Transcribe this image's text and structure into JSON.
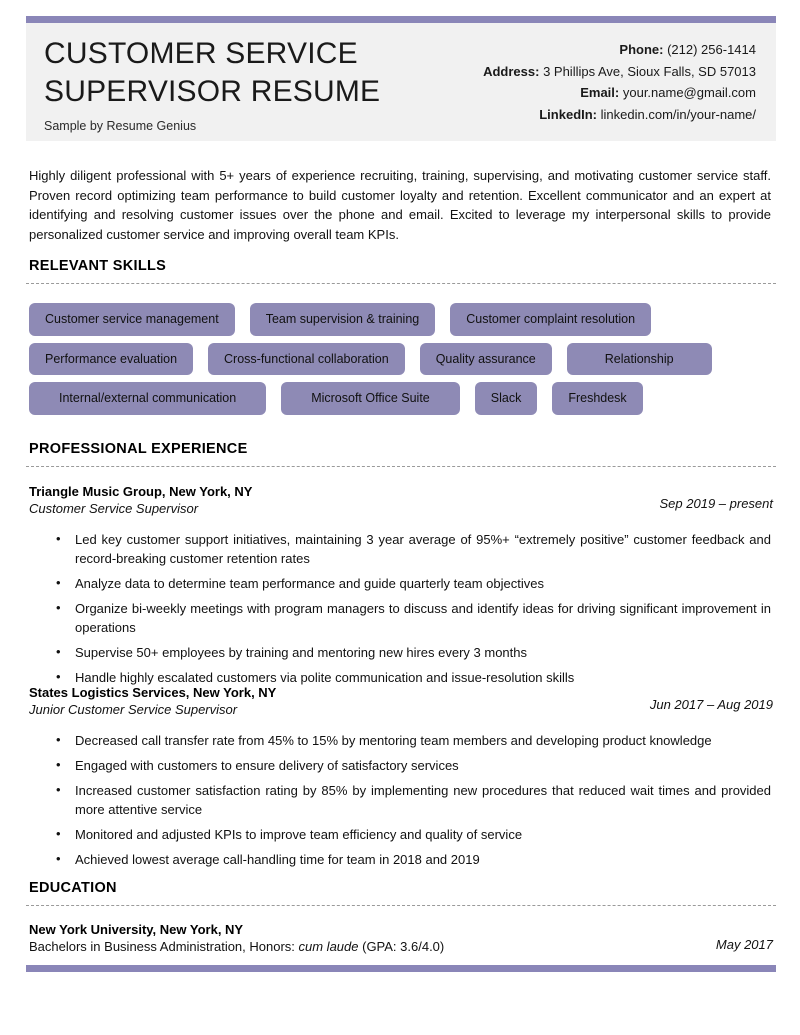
{
  "theme": {
    "accent_color": "#8a86b8",
    "tag_color": "#8e8ab5",
    "header_bg": "#f1f1f1"
  },
  "header": {
    "name_title": "CUSTOMER SERVICE\nSUPERVISOR RESUME",
    "byline": "Sample by Resume Genius",
    "contact": [
      {
        "label": "Phone:",
        "value": "(212) 256-1414"
      },
      {
        "label": "Address:",
        "value": "3 Phillips Ave, Sioux Falls, SD 57013"
      },
      {
        "label": "Email:",
        "value": "your.name@gmail.com"
      },
      {
        "label": "LinkedIn:",
        "value": "linkedin.com/in/your-name/"
      }
    ]
  },
  "summary": "Highly diligent professional with 5+ years of experience recruiting, training, supervising, and motivating customer service staff. Proven record optimizing team performance to build customer loyalty and retention. Excellent communicator and an expert at identifying and resolving customer issues over the phone and email. Excited to leverage my interpersonal skills to provide personalized customer service and improving overall team KPIs.",
  "sections": {
    "skills_heading": "RELEVANT SKILLS",
    "experience_heading": "PROFESSIONAL EXPERIENCE",
    "education_heading": "EDUCATION"
  },
  "skills": {
    "row1": [
      "Customer service management",
      "Team supervision & training",
      "Customer complaint resolution"
    ],
    "row2": [
      "Performance evaluation",
      "Cross-functional collaboration",
      "Quality assurance",
      "Relationship"
    ],
    "row3": [
      "Internal/external communication",
      "Microsoft Office Suite",
      "Slack",
      "Freshdesk"
    ]
  },
  "experience": [
    {
      "organization": "Triangle Music Group, New York, NY",
      "role": "Customer Service Supervisor",
      "date": "Sep 2019 – present",
      "bullets": [
        "Led key customer support initiatives, maintaining 3 year average of 95%+ “extremely positive” customer feedback and record-breaking customer retention rates",
        "Analyze data to determine team performance and guide quarterly team objectives",
        "Organize bi-weekly meetings with program managers to discuss and identify ideas for driving significant improvement in operations",
        "Supervise 50+ employees by training and mentoring new hires every 3 months",
        "Handle highly escalated customers via polite communication and issue-resolution skills"
      ]
    },
    {
      "organization": "States Logistics Services, New York, NY",
      "role": "Junior Customer Service Supervisor",
      "date": "Jun 2017 – Aug 2019",
      "bullets": [
        "Decreased call transfer rate from 45% to 15% by mentoring team members and developing product knowledge",
        "Engaged with customers to ensure delivery of satisfactory services",
        "Increased customer satisfaction rating by 85% by implementing new procedures that reduced wait times and provided more attentive service",
        "Monitored and adjusted KPIs to improve team efficiency and quality of service",
        "Achieved lowest average call-handling time for team in 2018 and 2019"
      ]
    }
  ],
  "education": {
    "school": "New York University, New York, NY",
    "degree_prefix": "Bachelors in Business Administration, Honors: ",
    "degree_honors": "cum laude",
    "degree_suffix": " (GPA: 3.6/4.0)",
    "date": "May 2017"
  }
}
